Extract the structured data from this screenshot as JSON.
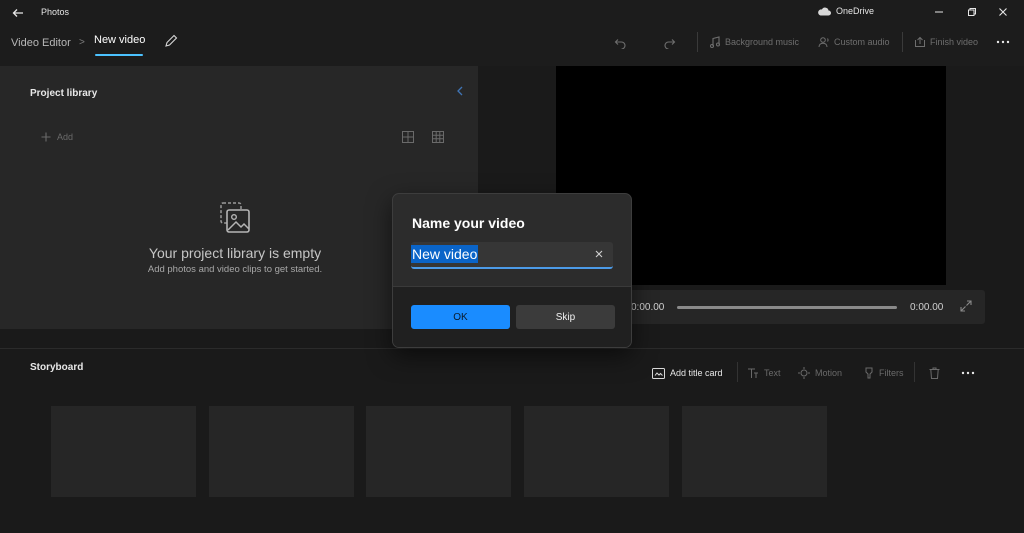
{
  "window": {
    "app_title": "Photos",
    "onedrive_label": "OneDrive"
  },
  "header": {
    "breadcrumb_root": "Video Editor",
    "breadcrumb_separator": ">",
    "project_name": "New video",
    "buttons": {
      "background_music": "Background music",
      "custom_audio": "Custom audio",
      "finish_video": "Finish video"
    }
  },
  "library": {
    "title": "Project library",
    "add_label": "Add",
    "empty_title": "Your project library is empty",
    "empty_subtitle": "Add photos and video clips to get started."
  },
  "player": {
    "current_time": "0:00.00",
    "total_time": "0:00.00",
    "progress": 0
  },
  "storyboard": {
    "title": "Storyboard",
    "add_title_card": "Add title card",
    "text_label": "Text",
    "motion_label": "Motion",
    "filters_label": "Filters",
    "slot_count": 5
  },
  "dialog": {
    "title": "Name your video",
    "input_value": "New video",
    "ok_label": "OK",
    "skip_label": "Skip"
  },
  "colors": {
    "accent": "#4cc2ff",
    "ok_button": "#1a8cff",
    "selection": "#0a64c8",
    "background": "#1a1a1a"
  },
  "icons": {
    "back": "back-arrow-icon",
    "cloud": "onedrive-cloud-icon",
    "edit": "pencil-icon",
    "undo": "undo-icon",
    "redo": "redo-icon",
    "music": "music-note-icon",
    "audio": "person-audio-icon",
    "export": "export-icon",
    "more": "more-icon",
    "add": "plus-icon",
    "grid_small": "grid-view-icon",
    "grid_large": "large-grid-icon",
    "empty_library": "media-stack-icon",
    "expand": "expand-icon",
    "title_card": "title-card-icon",
    "text": "text-icon",
    "motion": "motion-icon",
    "filters": "filters-icon",
    "delete": "trash-icon",
    "clear": "clear-icon"
  }
}
